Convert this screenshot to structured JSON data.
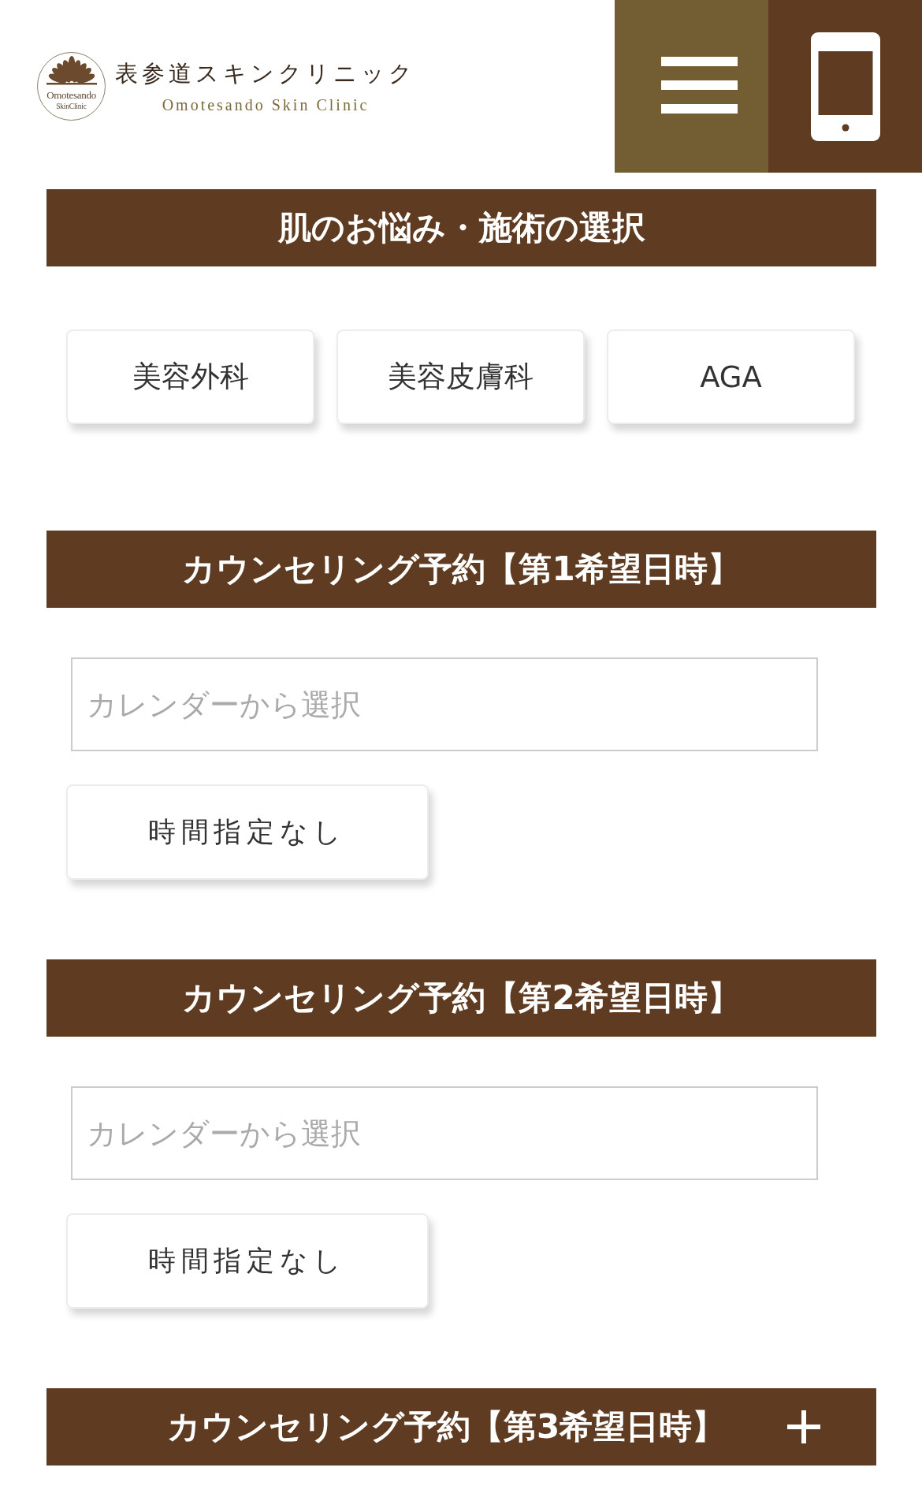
{
  "header": {
    "logo": {
      "emblem_lines": [
        "Omotesando",
        "SkinClinic"
      ],
      "name": "表参道スキンクリニック",
      "name_en": "Omotesando Skin Clinic"
    },
    "buttons": [
      {
        "kind": "menu"
      },
      {
        "kind": "phone"
      }
    ]
  },
  "sections": [
    {
      "kind": "choices",
      "title": "肌のお悩み・施術の選択",
      "options": [
        {
          "label": "美容外科",
          "selected": false
        },
        {
          "label": "美容皮膚科",
          "selected": false
        },
        {
          "label": "AGA",
          "selected": false
        }
      ]
    },
    {
      "kind": "datetime",
      "title": "カウンセリング予約【第1希望日時】",
      "date_field": {
        "placeholder": "カレンダーから選択"
      },
      "time_button": "時間指定なし"
    },
    {
      "kind": "datetime",
      "title": "カウンセリング予約【第2希望日時】",
      "date_field": {
        "placeholder": "カレンダーから選択"
      },
      "time_button": "時間指定なし"
    },
    {
      "kind": "collapsible",
      "title": "カウンセリング予約【第3希望日時】",
      "expanded": false
    }
  ]
}
